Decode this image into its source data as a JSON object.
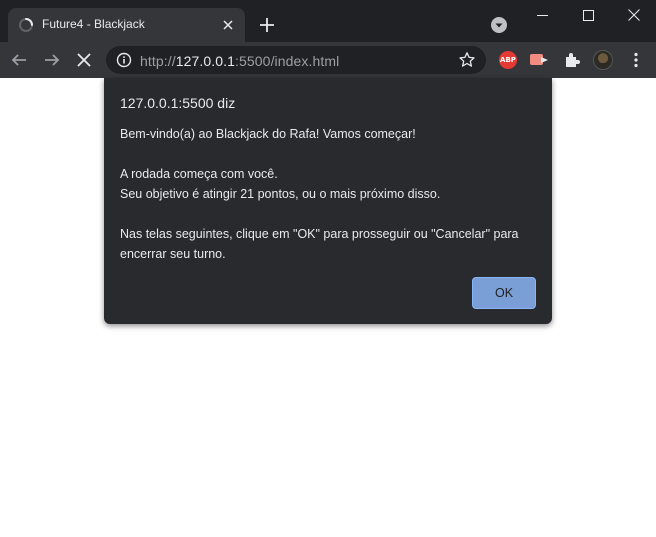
{
  "tab": {
    "title": "Future4 - Blackjack"
  },
  "omnibox": {
    "scheme": "http://",
    "host": "127.0.0.1",
    "rest": ":5500/index.html"
  },
  "extensions": {
    "abp_label": "ABP"
  },
  "dialog": {
    "title": "127.0.0.1:5500 diz",
    "lines": [
      "Bem-vindo(a) ao Blackjack do Rafa! Vamos começar!",
      "",
      "A rodada começa com você.",
      "Seu objetivo é atingir 21 pontos, ou o mais próximo disso.",
      "",
      "Nas telas seguintes, clique em \"OK\" para prosseguir ou \"Cancelar\" para",
      "encerrar seu turno."
    ],
    "ok_label": "OK",
    "button_color": "#7a9fd6"
  }
}
